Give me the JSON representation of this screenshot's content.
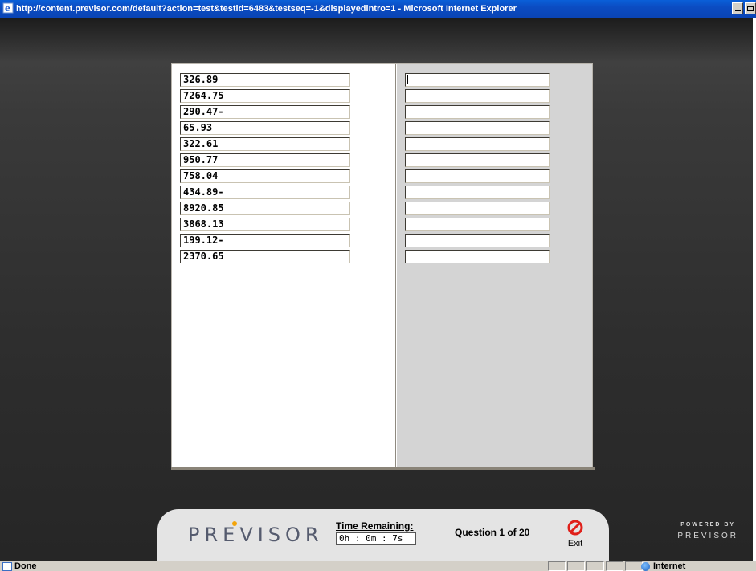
{
  "window": {
    "title": "http://content.previsor.com/default?action=test&testid=6483&testseq=-1&displayedintro=1 - Microsoft Internet Explorer"
  },
  "numbers": [
    "326.89",
    "7264.75",
    "290.47-",
    "65.93",
    "322.61",
    "950.77",
    "758.04",
    "434.89-",
    "8920.85",
    "3868.13",
    "199.12-",
    "2370.65"
  ],
  "answers": [
    "",
    "",
    "",
    "",
    "",
    "",
    "",
    "",
    "",
    "",
    "",
    ""
  ],
  "footer": {
    "logo": "PREVISOR",
    "time_label": "Time Remaining:",
    "time_value": "0h : 0m : 7s",
    "question": "Question 1 of 20",
    "exit_label": "Exit",
    "powered_by": "POWERED BY",
    "powered_logo": "PREVISOR"
  },
  "status": {
    "text": "Done",
    "zone": "Internet"
  },
  "colors": {
    "titlebar": "#0a4cc2",
    "panel_right_bg": "#d4d4d4",
    "footer_bg": "#e4e4e4",
    "exit_red": "#e0201a",
    "logo_dot": "#f3a40a"
  }
}
